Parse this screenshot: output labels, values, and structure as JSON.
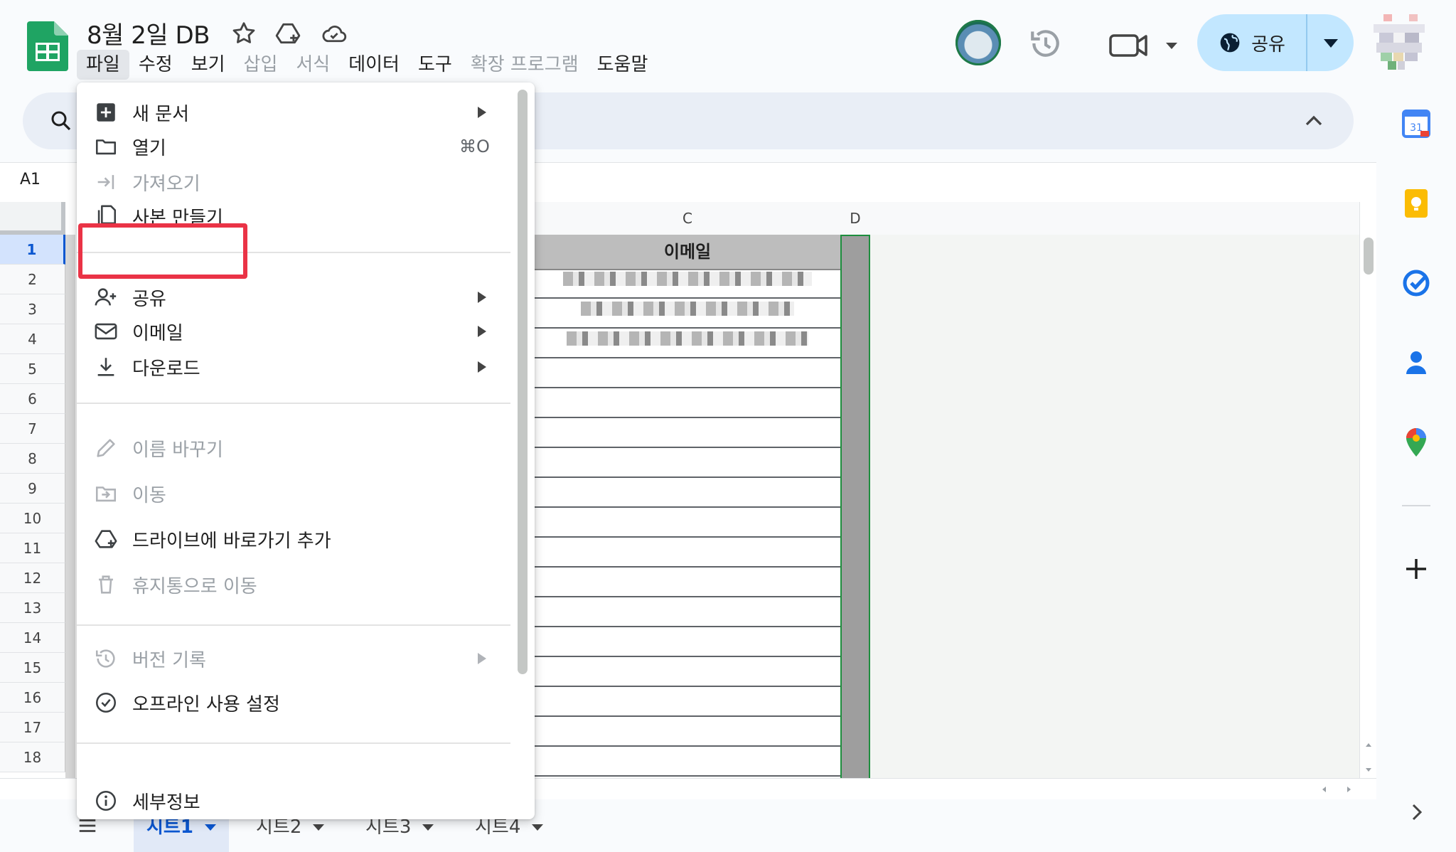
{
  "document": {
    "title": "8월 2일 DB"
  },
  "menu_bar": {
    "items": [
      {
        "label": "파일",
        "state": "active"
      },
      {
        "label": "수정",
        "state": "normal"
      },
      {
        "label": "보기",
        "state": "normal"
      },
      {
        "label": "삽입",
        "state": "disabled"
      },
      {
        "label": "서식",
        "state": "disabled"
      },
      {
        "label": "데이터",
        "state": "normal"
      },
      {
        "label": "도구",
        "state": "normal"
      },
      {
        "label": "확장 프로그램",
        "state": "disabled"
      },
      {
        "label": "도움말",
        "state": "normal"
      }
    ]
  },
  "toolbar": {
    "share_label": "공유"
  },
  "name_box": {
    "value": "A1"
  },
  "grid": {
    "columns": [
      "C",
      "D"
    ],
    "rows": [
      "1",
      "2",
      "3",
      "4",
      "5",
      "6",
      "7",
      "8",
      "9",
      "10",
      "11",
      "12",
      "13",
      "14",
      "15",
      "16",
      "17",
      "18"
    ],
    "header_cell": "이메일",
    "selected_row": "1"
  },
  "file_menu": {
    "items": [
      {
        "label": "새 문서",
        "icon": "new-doc-icon",
        "submenu": true,
        "disabled": false
      },
      {
        "label": "열기",
        "icon": "folder-open-icon",
        "shortcut": "⌘O",
        "disabled": false
      },
      {
        "label": "가져오기",
        "icon": "import-icon",
        "disabled": true
      },
      {
        "label": "사본 만들기",
        "icon": "copy-icon",
        "disabled": false,
        "highlighted": true
      },
      {
        "label": "공유",
        "icon": "add-person-icon",
        "submenu": true,
        "disabled": false
      },
      {
        "label": "이메일",
        "icon": "mail-icon",
        "submenu": true,
        "disabled": false
      },
      {
        "label": "다운로드",
        "icon": "download-icon",
        "submenu": true,
        "disabled": false
      },
      {
        "label": "이름 바꾸기",
        "icon": "pencil-icon",
        "disabled": true
      },
      {
        "label": "이동",
        "icon": "move-folder-icon",
        "disabled": true
      },
      {
        "label": "드라이브에 바로가기 추가",
        "icon": "drive-add-icon",
        "disabled": false
      },
      {
        "label": "휴지통으로 이동",
        "icon": "trash-icon",
        "disabled": true
      },
      {
        "label": "버전 기록",
        "icon": "history-icon",
        "submenu": true,
        "disabled": true
      },
      {
        "label": "오프라인 사용 설정",
        "icon": "offline-check-icon",
        "disabled": false
      },
      {
        "label": "세부정보",
        "icon": "info-icon",
        "disabled": false
      }
    ]
  },
  "sheet_tabs": [
    {
      "label": "시트1",
      "active": true
    },
    {
      "label": "시트2",
      "active": false
    },
    {
      "label": "시트3",
      "active": false
    },
    {
      "label": "시트4",
      "active": false
    }
  ],
  "colors": {
    "accent": "#0b57d0",
    "share_button": "#c2e7ff",
    "highlight": "#ea3346",
    "sheets_green": "#188038"
  }
}
